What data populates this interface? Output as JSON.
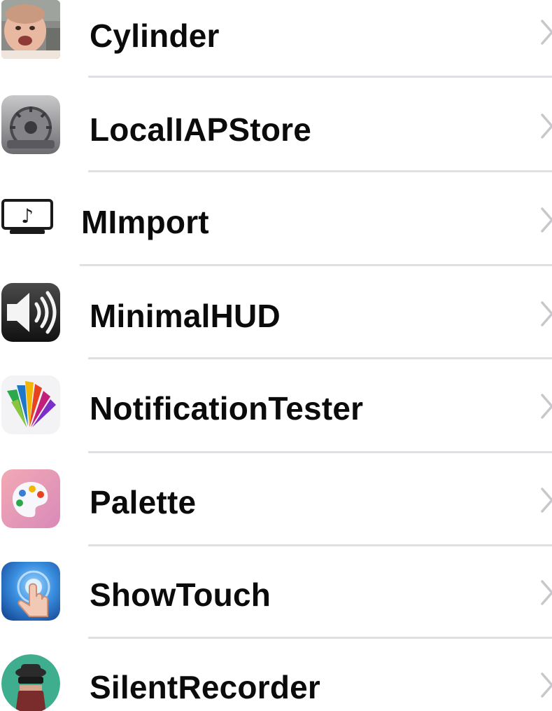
{
  "list": {
    "items": [
      {
        "label": "Cylinder",
        "icon": "baby-photo-icon"
      },
      {
        "label": "LocalIAPStore",
        "icon": "settings-dial-icon"
      },
      {
        "label": "MImport",
        "icon": "music-monitor-icon"
      },
      {
        "label": "MinimalHUD",
        "icon": "speaker-volume-icon"
      },
      {
        "label": "NotificationTester",
        "icon": "colorful-burst-icon"
      },
      {
        "label": "Palette",
        "icon": "paint-palette-icon"
      },
      {
        "label": "ShowTouch",
        "icon": "touch-hand-icon"
      },
      {
        "label": "SilentRecorder",
        "icon": "spy-agent-icon"
      }
    ]
  },
  "colors": {
    "background": "#ffffff",
    "text": "#0b0b0b",
    "separator": "#e0e0e4",
    "chevron": "#c7c7cc"
  }
}
